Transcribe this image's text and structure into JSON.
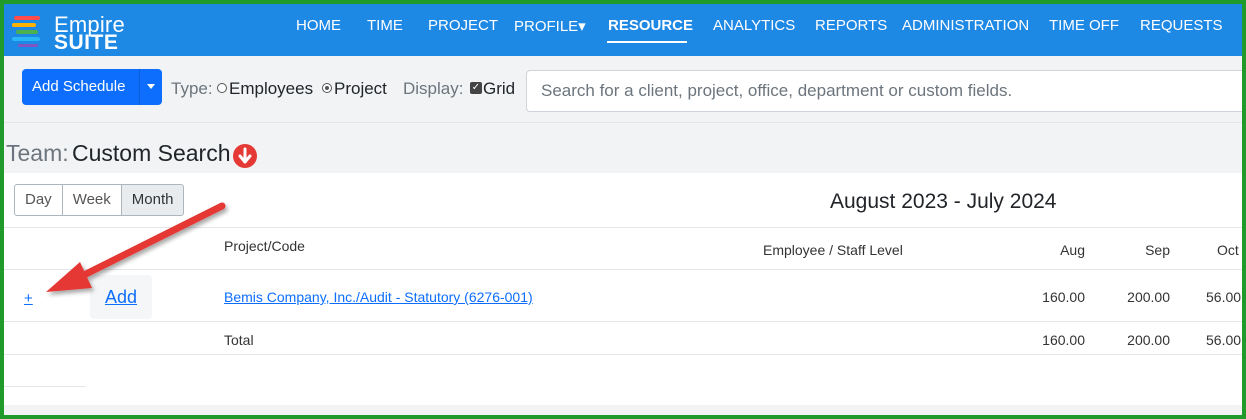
{
  "brand": {
    "name_line1": "Empire",
    "name_line2": "SUITE",
    "stripe_colors": [
      "#ff4b4b",
      "#ffb300",
      "#4caf50",
      "#29b6f6",
      "#7e57c2"
    ]
  },
  "nav": {
    "items": [
      {
        "label": "HOME"
      },
      {
        "label": "TIME"
      },
      {
        "label": "PROJECT"
      },
      {
        "label": "PROFILE▾"
      },
      {
        "label": "RESOURCE",
        "active": true
      },
      {
        "label": "ANALYTICS"
      },
      {
        "label": "REPORTS"
      },
      {
        "label": "ADMINISTRATION"
      },
      {
        "label": "TIME OFF"
      },
      {
        "label": "REQUESTS"
      }
    ]
  },
  "toolbar": {
    "add_schedule_label": "Add Schedule",
    "type_label": "Type:",
    "type_options": [
      {
        "label": "Employees",
        "selected": false
      },
      {
        "label": "Project",
        "selected": true
      }
    ],
    "display_label": "Display:",
    "display_option": {
      "label": "Grid",
      "checked": true
    },
    "search_placeholder": "Search for a client, project, office, department or custom fields."
  },
  "team": {
    "label": "Team:",
    "value": "Custom Search"
  },
  "view_toggle": {
    "options": [
      "Day",
      "Week",
      "Month"
    ],
    "active": "Month"
  },
  "date_range": "August 2023 - July 2024",
  "table": {
    "headers": {
      "project": "Project/Code",
      "employee": "Employee / Staff Level",
      "months": [
        "Aug",
        "Sep",
        "Oct"
      ]
    },
    "rows": [
      {
        "plus": "+",
        "add": "Add",
        "project": "Bemis Company, Inc./Audit - Statutory (6276-001)",
        "employee": "",
        "values": [
          "160.00",
          "200.00",
          "56.00"
        ]
      }
    ],
    "total": {
      "label": "Total",
      "values": [
        "160.00",
        "200.00",
        "56.00"
      ]
    }
  },
  "colors": {
    "navbar": "#1e88e5",
    "primary": "#0d6efd",
    "frame_border": "#1f9a2b",
    "annotation_arrow": "#e53935"
  }
}
